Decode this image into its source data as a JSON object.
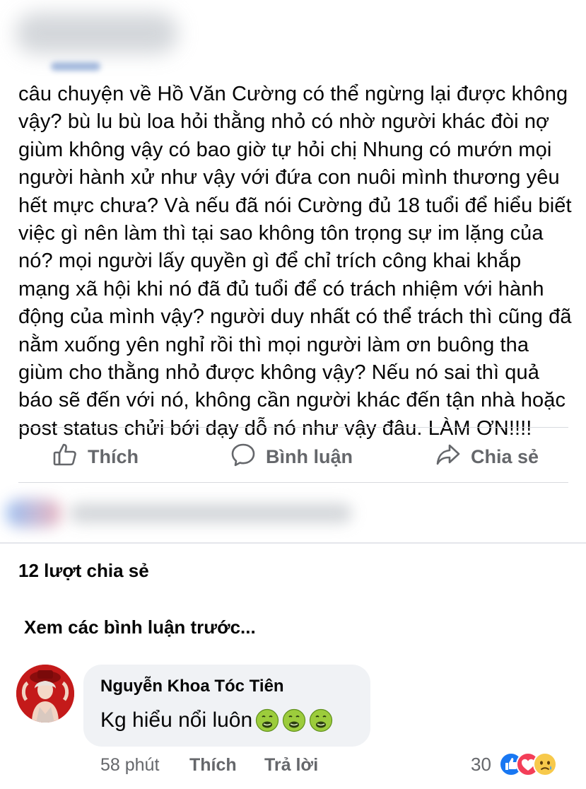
{
  "post": {
    "text": "câu chuyện về Hồ Văn Cường có thể ngừng lại được không vậy? bù lu bù loa hỏi thằng nhỏ có nhờ người khác đòi nợ giùm không vậy có bao giờ tự hỏi chị Nhung có mướn mọi người hành xử như vậy với đứa con nuôi mình thương yêu hết mực chưa? Và nếu đã nói Cường đủ 18 tuổi để hiểu biết việc gì nên làm thì tại sao không tôn trọng sự im lặng của nó? mọi người lấy quyền gì để chỉ trích công khai khắp mạng xã hội khi nó đã đủ tuổi để có trách nhiệm với hành động của mình vậy? người duy nhất có thể trách thì cũng đã nằm xuống yên nghỉ rồi thì mọi người làm ơn buông tha giùm cho thằng nhỏ được không vậy? Nếu nó sai thì quả báo sẽ đến với nó, không cần người khác đến tận nhà hoặc post status chửi bới dạy dỗ nó như vậy đâu. LÀM ƠN!!!!"
  },
  "actions": {
    "like": "Thích",
    "comment": "Bình luận",
    "share": "Chia sẻ"
  },
  "share_count": "12 lượt chia sẻ",
  "previous_comments": "Xem các bình luận trước...",
  "comment": {
    "author": "Nguyễn Khoa Tóc Tiên",
    "text": "Kg hiểu nổi luôn",
    "emoji": "nauseated-face",
    "time": "58 phút",
    "like": "Thích",
    "reply": "Trả lời",
    "reaction_count": "30",
    "reactions": [
      "like",
      "love",
      "sad"
    ]
  },
  "colors": {
    "secondary_text": "#65676b",
    "bubble_bg": "#f0f2f5",
    "like_blue": "#1877f2",
    "love_red": "#f33e58"
  }
}
